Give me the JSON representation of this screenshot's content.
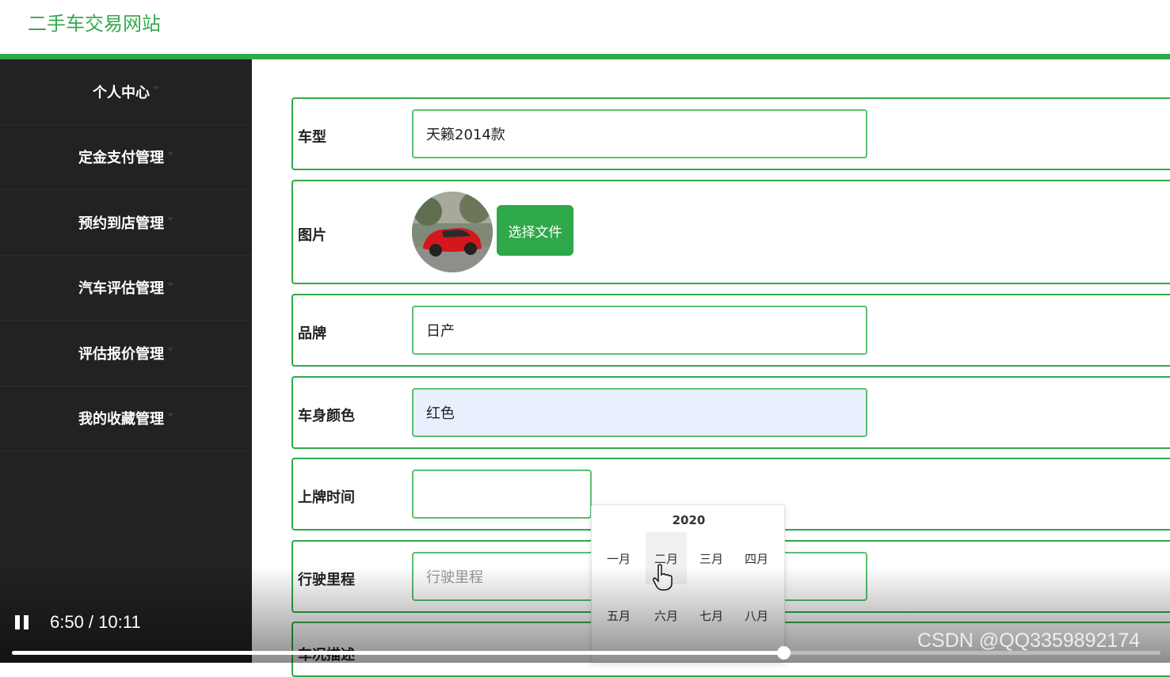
{
  "site": {
    "title": "二手车交易网站"
  },
  "sidebar": {
    "items": [
      {
        "label": "个人中心"
      },
      {
        "label": "定金支付管理"
      },
      {
        "label": "预约到店管理"
      },
      {
        "label": "汽车评估管理"
      },
      {
        "label": "评估报价管理"
      },
      {
        "label": "我的收藏管理"
      }
    ]
  },
  "form": {
    "model": {
      "label": "车型",
      "value": "天籁2014款"
    },
    "image": {
      "label": "图片",
      "button": "选择文件"
    },
    "brand": {
      "label": "品牌",
      "value": "日产"
    },
    "color": {
      "label": "车身颜色",
      "value": "红色"
    },
    "plate_date": {
      "label": "上牌时间",
      "value": ""
    },
    "mileage": {
      "label": "行驶里程",
      "placeholder": "行驶里程"
    },
    "condition": {
      "label": "车况描述"
    }
  },
  "month_picker": {
    "year": "2020",
    "months": [
      "一月",
      "二月",
      "三月",
      "四月",
      "五月",
      "六月",
      "七月",
      "八月"
    ],
    "hovered": "二月"
  },
  "video": {
    "time": "6:50 / 10:11",
    "progress_fraction": 0.672,
    "watermark": "CSDN @QQ3359892174"
  },
  "colors": {
    "accent": "#2fa84a",
    "sidebar": "#222224"
  }
}
